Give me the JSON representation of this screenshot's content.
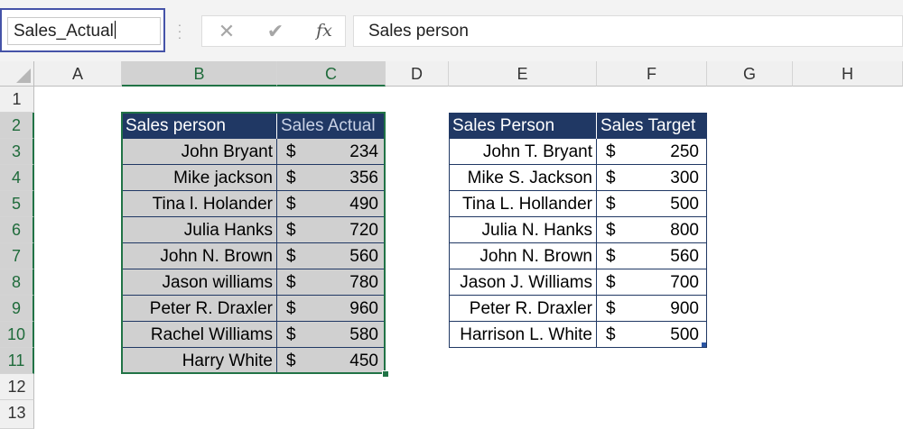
{
  "name_box": {
    "value": "Sales_Actual"
  },
  "formula_bar": {
    "cancel_symbol": "✕",
    "enter_symbol": "✔",
    "fx_label": "fx",
    "content": "Sales person"
  },
  "columns": [
    "A",
    "B",
    "C",
    "D",
    "E",
    "F",
    "G",
    "H"
  ],
  "rows": [
    "1",
    "2",
    "3",
    "4",
    "5",
    "6",
    "7",
    "8",
    "9",
    "10",
    "11",
    "12",
    "13"
  ],
  "table_actual": {
    "headers": [
      "Sales person",
      "Sales Actual"
    ],
    "rows": [
      {
        "name": "John Bryant",
        "currency": "$",
        "amount": "234"
      },
      {
        "name": "Mike jackson",
        "currency": "$",
        "amount": "356"
      },
      {
        "name": "Tina l. Holander",
        "currency": "$",
        "amount": "490"
      },
      {
        "name": "Julia Hanks",
        "currency": "$",
        "amount": "720"
      },
      {
        "name": "John  N. Brown",
        "currency": "$",
        "amount": "560"
      },
      {
        "name": "Jason williams",
        "currency": "$",
        "amount": "780"
      },
      {
        "name": "Peter R. Draxler",
        "currency": "$",
        "amount": "960"
      },
      {
        "name": "Rachel Williams",
        "currency": "$",
        "amount": "580"
      },
      {
        "name": "Harry White",
        "currency": "$",
        "amount": "450"
      }
    ]
  },
  "table_target": {
    "headers": [
      "Sales Person",
      "Sales Target"
    ],
    "rows": [
      {
        "name": "John T. Bryant",
        "currency": "$",
        "amount": "250"
      },
      {
        "name": "Mike S. Jackson",
        "currency": "$",
        "amount": "300"
      },
      {
        "name": "Tina L. Hollander",
        "currency": "$",
        "amount": "500"
      },
      {
        "name": "Julia N. Hanks",
        "currency": "$",
        "amount": "800"
      },
      {
        "name": "John N. Brown",
        "currency": "$",
        "amount": "560"
      },
      {
        "name": "Jason J. Williams",
        "currency": "$",
        "amount": "700"
      },
      {
        "name": "Peter R. Draxler",
        "currency": "$",
        "amount": "900"
      },
      {
        "name": "Harrison L. White",
        "currency": "$",
        "amount": "500"
      }
    ]
  },
  "colors": {
    "header_fill": "#203864",
    "selection_green": "#217346",
    "selected_fill": "#d0d0d0",
    "namebox_border": "#4553a8"
  }
}
